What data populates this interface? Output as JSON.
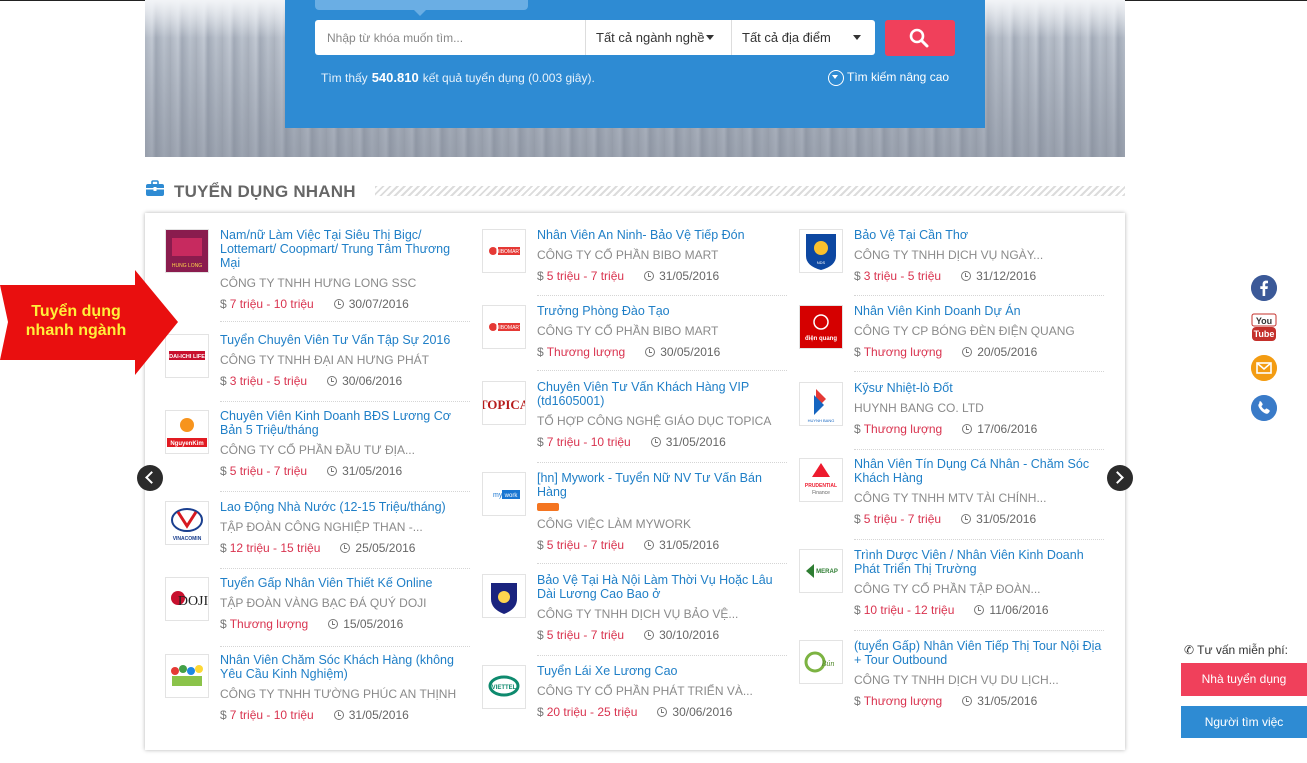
{
  "search": {
    "placeholder": "Nhập từ khóa muốn tìm...",
    "industry": "Tất cả ngành nghề",
    "location": "Tất cả địa điểm",
    "result_prefix": "Tìm thấy",
    "result_count": "540.810",
    "result_suffix": "kết quả tuyển dụng (0.003 giây).",
    "advanced": "Tìm kiếm nâng cao"
  },
  "section": {
    "title": "TUYỂN DỤNG NHANH"
  },
  "annotation": {
    "line1": "Tuyển dụng",
    "line2": "nhanh ngành"
  },
  "columns": [
    [
      {
        "title": "Nam/nữ Làm Việc Tại Siêu Thị Bigc/ Lottemart/ Coopmart/ Trung Tâm Thương Mại",
        "company": "CÔNG TY TNHH HƯNG LONG SSC",
        "salary": "7 triệu - 10 triệu",
        "date": "30/07/2016",
        "logo": "hung-long-logo"
      },
      {
        "title": "Tuyển Chuyên Viên Tư Vấn Tập Sự 2016",
        "company": "CÔNG TY TNHH ĐẠI AN HƯNG PHÁT",
        "salary": "3 triệu - 5 triệu",
        "date": "30/06/2016",
        "logo": "dai-ichi-life-logo"
      },
      {
        "title": "Chuyên Viên Kinh Doanh BĐS Lương Cơ Bản 5 Triệu/tháng",
        "company": "CÔNG TY CỔ PHẦN ĐẦU TƯ ĐỊA...",
        "salary": "5 triệu - 7 triệu",
        "date": "31/05/2016",
        "logo": "nguyen-kim-logo"
      },
      {
        "title": "Lao Động Nhà Nước (12-15 Triệu/tháng)",
        "company": "TẬP ĐOÀN CÔNG NGHIỆP THAN -...",
        "salary": "12 triệu - 15 triệu",
        "date": "25/05/2016",
        "logo": "vinacomin-logo"
      },
      {
        "title": "Tuyển Gấp Nhân Viên Thiết Kế Online",
        "company": "TẬP ĐOÀN VÀNG BẠC ĐÁ QUÝ DOJI",
        "salary": "Thương lượng",
        "date": "15/05/2016",
        "logo": "doji-logo"
      },
      {
        "title": "Nhân Viên Chăm Sóc Khách Hàng (không Yêu Cầu Kinh Nghiệm)",
        "company": "CÔNG TY TNHH TƯỜNG PHÚC AN THỊNH",
        "salary": "7 triệu - 10 triệu",
        "date": "31/05/2016",
        "logo": "tuong-phuc-logo"
      }
    ],
    [
      {
        "title": "Nhân Viên An Ninh- Bảo Vệ Tiếp Đón",
        "company": "CÔNG TY CỔ PHẦN BIBO MART",
        "salary": "5 triệu - 7 triệu",
        "date": "31/05/2016",
        "logo": "bibo-mart-logo"
      },
      {
        "title": "Trưởng Phòng Đào Tạo",
        "company": "CÔNG TY CỔ PHẦN BIBO MART",
        "salary": "Thương lượng",
        "date": "30/05/2016",
        "logo": "bibo-mart-logo"
      },
      {
        "title": "Chuyên Viên Tư Vấn Khách Hàng VIP (td1605001)",
        "company": "TỔ HỢP CÔNG NGHỆ GIÁO DỤC TOPICA",
        "salary": "7 triệu - 10 triệu",
        "date": "31/05/2016",
        "logo": "topica-logo"
      },
      {
        "title": "[hn] Mywork - Tuyển Nữ NV Tư Vấn Bán Hàng",
        "company": "CÔNG VIỆC LÀM MYWORK",
        "salary": "5 triệu - 7 triệu",
        "date": "31/05/2016",
        "logo": "mywork-logo",
        "hot": true
      },
      {
        "title": "Bảo Vệ Tại Hà Nội Làm Thời Vụ Hoặc Lâu Dài Lương Cao Bao ở",
        "company": "CÔNG TY TNHH DỊCH VỤ BẢO VỆ...",
        "salary": "5 triệu - 7 triệu",
        "date": "30/10/2016",
        "logo": "dai-long-logo"
      },
      {
        "title": "Tuyển Lái Xe Lương Cao",
        "company": "CÔNG TY CỔ PHẦN PHÁT TRIỂN VÀ...",
        "salary": "20 triệu - 25 triệu",
        "date": "30/06/2016",
        "logo": "viettel-logo"
      }
    ],
    [
      {
        "title": "Bảo Vệ Tại Cần Thơ",
        "company": "CÔNG TY TNHH DỊCH VỤ NGÀY...",
        "salary": "3 triệu - 5 triệu",
        "date": "31/12/2016",
        "logo": "nds-security-logo"
      },
      {
        "title": "Nhân Viên Kinh Doanh Dự Án",
        "company": "CÔNG TY CP BÓNG ĐÈN ĐIỆN QUANG",
        "salary": "Thương lượng",
        "date": "20/05/2016",
        "logo": "dien-quang-logo"
      },
      {
        "title": "Kỹsư Nhiệt-lò Đốt",
        "company": "HUYNH BANG CO. LTD",
        "salary": "Thương lượng",
        "date": "17/06/2016",
        "logo": "huynh-bang-logo"
      },
      {
        "title": "Nhân Viên Tín Dụng Cá Nhân - Chăm Sóc Khách Hàng",
        "company": "CÔNG TY TNHH MTV TÀI CHÍNH...",
        "salary": "5 triệu - 7 triệu",
        "date": "31/05/2016",
        "logo": "prudential-logo"
      },
      {
        "title": "Trình Dược Viên / Nhân Viên Kinh Doanh Phát Triển Thị Trường",
        "company": "CÔNG TY CỔ PHẦN TẬP ĐOÀN...",
        "salary": "10 triệu - 12 triệu",
        "date": "11/06/2016",
        "logo": "merap-logo"
      },
      {
        "title": "(tuyển Gấp) Nhân Viên Tiếp Thị Tour Nội Địa + Tour Outbound",
        "company": "CÔNG TY TNHH DỊCH VỤ DU LỊCH...",
        "salary": "Thương lượng",
        "date": "31/05/2016",
        "logo": "du-lich-logo"
      }
    ]
  ],
  "sidebar": {
    "consult": "Tư vấn miễn phí:",
    "employer_btn": "Nhà tuyển dụng",
    "seeker_btn": "Người tìm việc",
    "youtube_top": "You",
    "youtube_bottom": "Tube"
  },
  "colors": {
    "primary_blue": "#2e8bd3",
    "accent_pink": "#f0405b",
    "link_blue": "#1f7fc7",
    "salary_red": "#d9334f"
  }
}
